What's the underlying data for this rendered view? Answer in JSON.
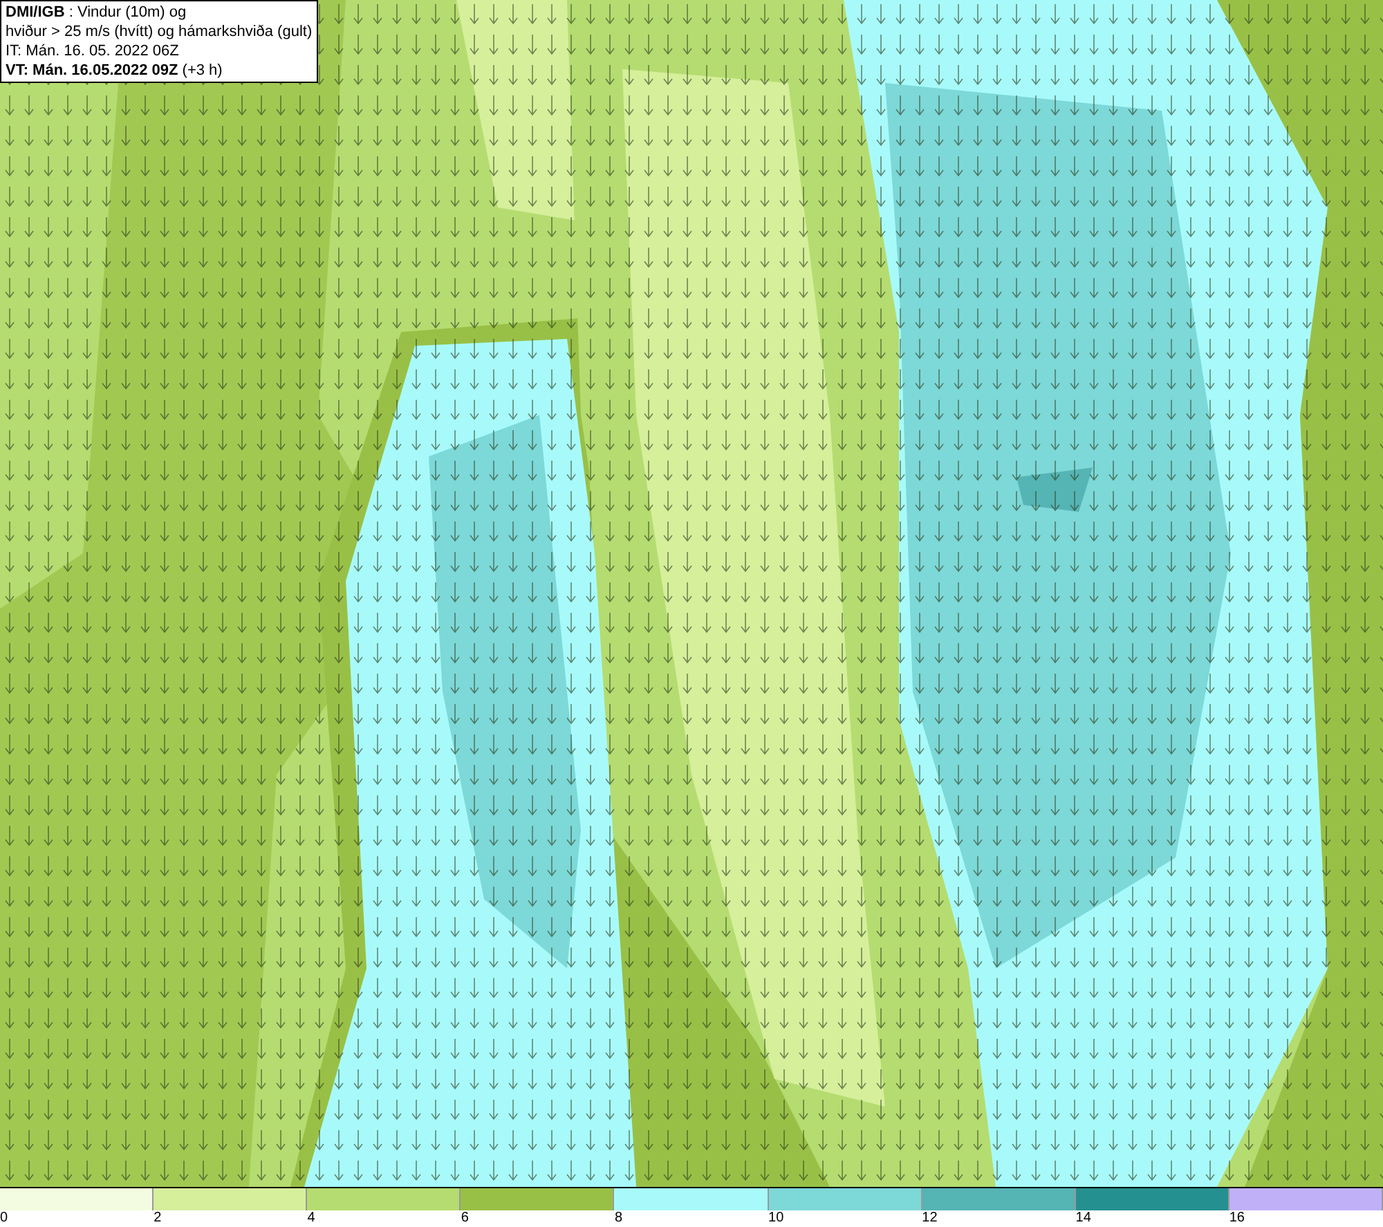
{
  "title_box": {
    "lines": [
      "**DMI/IGB** : Vindur (10m) og",
      "hviður > 25 m/s (hvítt) og hámarkshviða (gult)",
      "IT: Mán. 16. 05. 2022 06Z",
      "**VT: Mán. 16.05.2022 09Z** (+3 h)"
    ]
  },
  "legend": {
    "bins": [
      {
        "color": "#f3fce0"
      },
      {
        "color": "#d6ef9b"
      },
      {
        "color": "#b5dc70"
      },
      {
        "color": "#99c046"
      },
      {
        "color": "#a8fafa"
      },
      {
        "color": "#7dd8d8"
      },
      {
        "color": "#55b4b4"
      },
      {
        "color": "#259090"
      },
      {
        "color": "#c0b0f8"
      }
    ],
    "ticks": [
      "0",
      "2",
      "4",
      "6",
      "8",
      "10",
      "12",
      "14",
      "16"
    ]
  }
}
